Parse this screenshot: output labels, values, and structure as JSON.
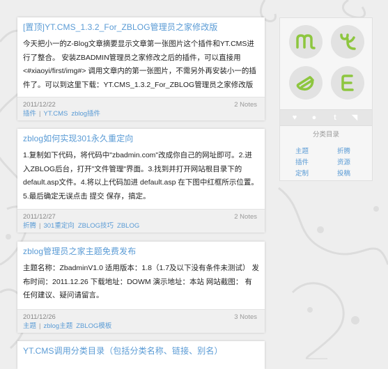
{
  "colors": {
    "link": "#5a9bd5",
    "accent_green": "#8dc63f"
  },
  "posts": [
    {
      "title": "[置顶]YT.CMS_1.3.2_For_ZBLOG管理员之家修改版",
      "body": "今天把小一的Z-Blog文章摘要显示文章第一张图片这个插件和YT.CMS进行了整合。 安装ZBADMIN管理员之家修改之后的插件，可以直接用<#xiaoyi/first/img#> 调用文章内的第一张图片，不需另外再安装小一的插件了。可以到这里下载：YT.CMS_1.3.2_For_ZBLOG管理员之家修改版",
      "date": "2011/12/22",
      "notes": "2 Notes",
      "category": "插件",
      "tags": [
        "YT.CMS",
        "zblog插件"
      ]
    },
    {
      "title": "zblog如何实现301永久重定向",
      "body": "1.复制如下代码，将代码中\"zbadmin.com\"改成你自己的网址即可。2.进入ZBLOG后台，打开\"文件管理\"界面。3.找到并打开网站根目录下的 default.asp文件。4.将以上代码加进 default.asp 在下图中红框所示位置。5.最后确定无误点击 提交 保存，搞定。",
      "date": "2011/12/27",
      "notes": "2 Notes",
      "category": "折腾",
      "tags": [
        "301重定向",
        "ZBLOG技巧",
        "ZBLOG"
      ]
    },
    {
      "title": "zblog管理员之家主题免费发布",
      "body": "主题名称：ZbadminV1.0 适用版本：1.8（1.7及以下没有条件未测试） 发布时间：2011.12.26 下载地址：DOWM 演示地址：本站 网站截图： 有任何建议、疑问请留言。",
      "date": "2011/12/26",
      "notes": "3 Notes",
      "category": "主题",
      "tags": [
        "zblog主题",
        "ZBLOG模板"
      ]
    },
    {
      "title": "YT.CMS调用分类目录（包括分类名称、链接、别名）"
    }
  ],
  "sidebar": {
    "avatar_letters": [
      "m",
      "e",
      "e",
      "E"
    ],
    "social_icons": [
      "heart-icon",
      "chat-icon",
      "tumblr-icon",
      "rss-icon"
    ],
    "category_title": "分类目录",
    "categories": [
      "主题",
      "折腾",
      "插件",
      "资源",
      "定制",
      "投稿"
    ]
  }
}
